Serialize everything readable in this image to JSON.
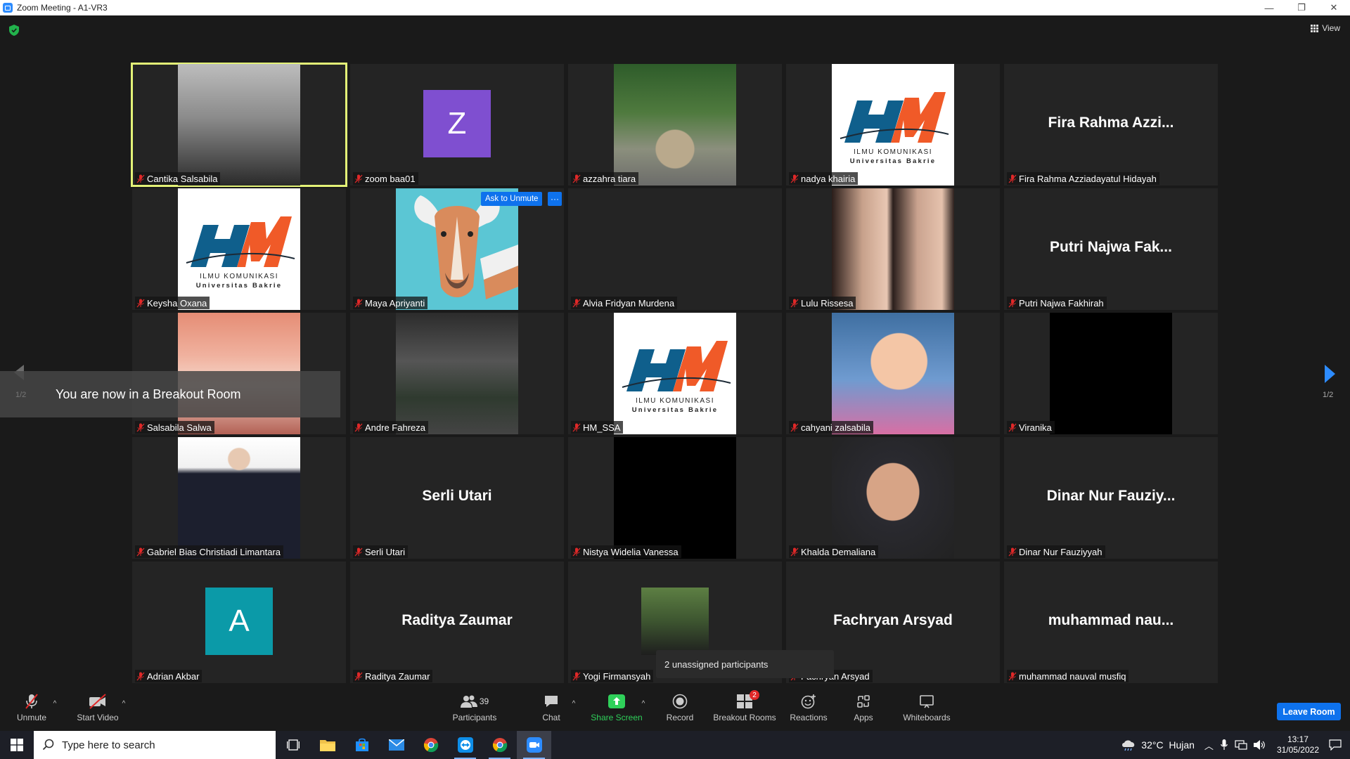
{
  "window": {
    "title": "Zoom Meeting - A1-VR3",
    "controls": [
      "—",
      "❐",
      "✕"
    ]
  },
  "top": {
    "view_label": "View"
  },
  "tiles": [
    {
      "name": "Cantika Salsabila",
      "kind": "photo",
      "style": "ph-bw",
      "active": true,
      "muted": true
    },
    {
      "name": "zoom baa01",
      "kind": "letter",
      "letter": "Z",
      "color": "#7f4fd0",
      "muted": true
    },
    {
      "name": "azzahra tiara",
      "kind": "photo",
      "style": "ph-garden",
      "muted": true
    },
    {
      "name": "nadya khairia",
      "kind": "logo",
      "muted": true
    },
    {
      "name": "Fira Rahma Azziadayatul Hidayah",
      "kind": "text",
      "display": "Fira Rahma Azzi...",
      "muted": true
    },
    {
      "name": "Keysha Oxana",
      "kind": "logo",
      "muted": true
    },
    {
      "name": "Maya Apriyanti",
      "kind": "photo",
      "style": "ph-giraffe",
      "muted": true
    },
    {
      "name": "Alvia Fridyan Murdena",
      "kind": "empty",
      "muted": true
    },
    {
      "name": "Lulu Rissesa",
      "kind": "photo",
      "style": "ph-girls",
      "muted": true
    },
    {
      "name": "Putri Najwa Fakhirah",
      "kind": "text",
      "display": "Putri Najwa Fak...",
      "muted": true
    },
    {
      "name": "Salsabila Salwa",
      "kind": "photo",
      "style": "ph-salsa",
      "muted": true
    },
    {
      "name": "Andre Fahreza",
      "kind": "photo",
      "style": "ph-car",
      "muted": true
    },
    {
      "name": "HM_SSA",
      "kind": "logo",
      "muted": true
    },
    {
      "name": "cahyani zalsabila",
      "kind": "photo",
      "style": "ph-kid",
      "muted": true
    },
    {
      "name": "Viranika",
      "kind": "photo",
      "style": "ph-black",
      "muted": true
    },
    {
      "name": "Gabriel Bias Christiadi Limantara",
      "kind": "photo",
      "style": "ph-suit",
      "muted": true
    },
    {
      "name": "Serli Utari",
      "kind": "text",
      "display": "Serli Utari",
      "muted": true
    },
    {
      "name": "Nistya Widelia Vanessa",
      "kind": "photo",
      "style": "ph-black",
      "muted": true
    },
    {
      "name": "Khalda Demaliana",
      "kind": "photo",
      "style": "ph-hijab",
      "muted": true
    },
    {
      "name": "Dinar Nur Fauziyyah",
      "kind": "text",
      "display": "Dinar Nur Fauziy...",
      "muted": true
    },
    {
      "name": "Adrian Akbar",
      "kind": "letter",
      "letter": "A",
      "color": "#0b9aa8",
      "muted": true
    },
    {
      "name": "Raditya Zaumar",
      "kind": "text",
      "display": "Raditya Zaumar",
      "muted": true
    },
    {
      "name": "Yogi Firmansyah",
      "kind": "photo",
      "style": "ph-yogi",
      "small": true,
      "muted": true
    },
    {
      "name": "Fachryan Arsyad",
      "kind": "text",
      "display": "Fachryan Arsyad",
      "muted": true
    },
    {
      "name": "muhammad nauval musfiq",
      "kind": "text",
      "display": "muhammad nau...",
      "muted": true
    }
  ],
  "logo": {
    "line1": "ILMU KOMUNIKASI",
    "line2": "Universitas Bakrie",
    "letters": "HM"
  },
  "hover": {
    "ask_unmute": "Ask to Unmute",
    "more": "···"
  },
  "breakout": {
    "page": "1/2",
    "message": "You are now in a Breakout Room"
  },
  "pagination": {
    "indicator": "1/2"
  },
  "tooltip": {
    "unassigned": "2 unassigned participants"
  },
  "toolbar": {
    "unmute": "Unmute",
    "start_video": "Start Video",
    "participants": "Participants",
    "participants_count": "39",
    "chat": "Chat",
    "share_screen": "Share Screen",
    "record": "Record",
    "breakout_rooms": "Breakout Rooms",
    "breakout_badge": "2",
    "reactions": "Reactions",
    "apps": "Apps",
    "whiteboards": "Whiteboards",
    "leave_room": "Leave Room",
    "caret": "^"
  },
  "taskbar": {
    "search_placeholder": "Type here to search",
    "weather": "32°C  Hujan",
    "time": "13:17",
    "date": "31/05/2022"
  },
  "colors": {
    "accent_blue": "#0e72ed",
    "active_speaker": "#e3f277",
    "share_green": "#2fd05a",
    "mute_red": "#e02828"
  }
}
